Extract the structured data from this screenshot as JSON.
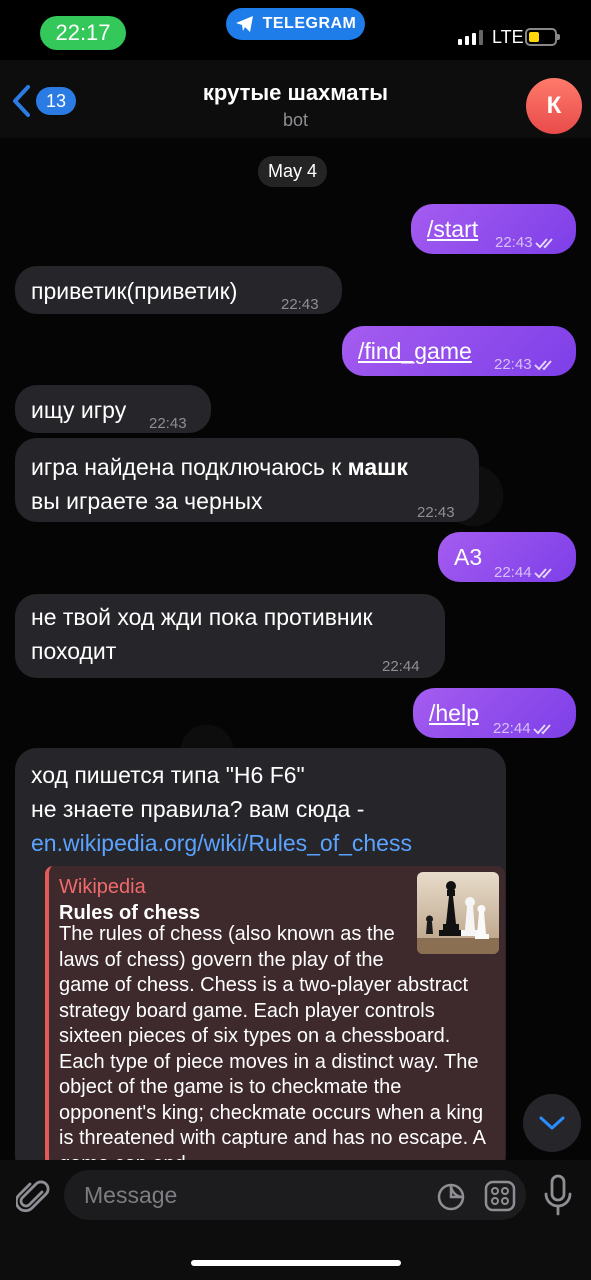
{
  "status_bar": {
    "time": "22:17",
    "app_pill": "TELEGRAM",
    "network": "LTE",
    "battery_level": 0.4
  },
  "header": {
    "unread_count": "13",
    "title": "крутые шахматы",
    "subtitle": "bot",
    "avatar_letter": "К"
  },
  "date_chip": "May 4",
  "messages": [
    {
      "dir": "out",
      "text": "/start",
      "time": "22:43"
    },
    {
      "dir": "in",
      "text": "приветик(приветик)",
      "time": "22:43"
    },
    {
      "dir": "out",
      "text": "/find_game",
      "time": "22:43"
    },
    {
      "dir": "in",
      "text": "ищу игру",
      "time": "22:43"
    },
    {
      "dir": "in",
      "text_prefix": "игра найдена подключаюсь к ",
      "text_bold": "машк",
      "text_line2": "вы играете за черных",
      "time": "22:43"
    },
    {
      "dir": "out",
      "text": "А3",
      "time": "22:44"
    },
    {
      "dir": "in",
      "text_line1": "не твой ход жди пока противник",
      "text_line2": "походит",
      "time": "22:44"
    },
    {
      "dir": "out",
      "text": "/help",
      "time": "22:44"
    },
    {
      "dir": "in",
      "text_line1": "ход пишется типа \"H6 F6\"",
      "text_line2": "не знаете правила? вам сюда -",
      "link": "en.wikipedia.org/wiki/Rules_of_chess",
      "preview": {
        "site": "Wikipedia",
        "title": "Rules of chess",
        "text": "The rules of chess (also known as the laws of chess) govern the play of the game of chess. Chess is a two-player abstract strategy board game. Each player controls sixteen pieces of six types on a chessboard. Each type of piece moves in a distinct way. The object of the game is to checkmate the opponent's king; checkmate occurs when a king is threatened with capture and has no escape. A game can end"
      }
    }
  ],
  "input": {
    "placeholder": "Message"
  },
  "colors": {
    "outgoing": "#9b57f0",
    "incoming": "#262529",
    "link": "#5aa3ff",
    "accent": "#2a7be4",
    "preview_bar": "#e35a5a"
  },
  "icons": [
    "telegram-icon",
    "back-chevron-icon",
    "double-check-icon",
    "chevron-down-icon",
    "paperclip-icon",
    "sticker-icon",
    "emoji-grid-icon",
    "microphone-icon"
  ]
}
